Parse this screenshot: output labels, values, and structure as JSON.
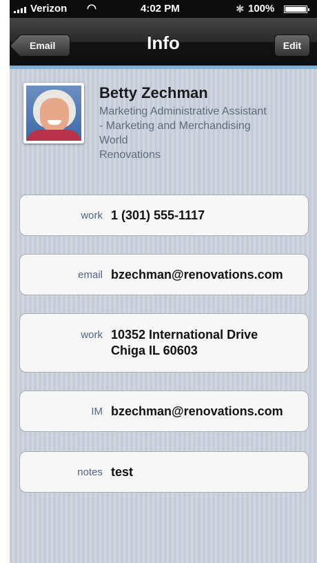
{
  "status_bar": {
    "carrier": "Verizon",
    "time": "4:02 PM",
    "battery": "100%"
  },
  "navbar": {
    "back_label": "Email",
    "title": "Info",
    "edit_label": "Edit"
  },
  "contact": {
    "name": "Betty Zechman",
    "subtitle_lines": [
      "Marketing Administrative Assistant",
      "- Marketing and Merchandising",
      "World",
      "Renovations"
    ]
  },
  "fields": [
    {
      "label": "work",
      "value_lines": [
        "1 (301) 555-1117"
      ]
    },
    {
      "label": "email",
      "value_lines": [
        "bzechman@renovations.com"
      ]
    },
    {
      "label": "work",
      "value_lines": [
        "10352 International Drive",
        "Chiga IL 60603"
      ]
    },
    {
      "label": "IM",
      "value_lines": [
        "bzechman@renovations.com"
      ]
    },
    {
      "label": "notes",
      "value_lines": [
        "test"
      ]
    }
  ],
  "icons": [
    "signal-icon",
    "wifi-icon",
    "bluetooth-icon",
    "battery-icon",
    "back-chevron-icon"
  ],
  "colors": {
    "navbar": "#1a1a1a",
    "navbar_accent": "#7fb0d6",
    "label": "#4e6488",
    "subtitle": "#5e6a7d",
    "background": "#cbd1dc"
  }
}
